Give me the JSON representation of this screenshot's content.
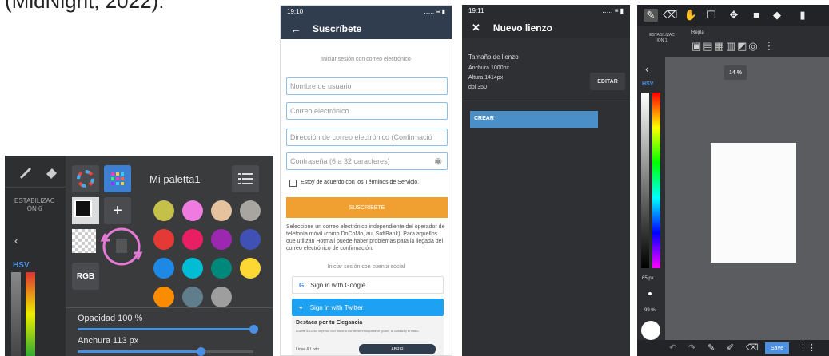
{
  "caption": "(MidNight, 2022).",
  "palette_panel": {
    "stabilizer": "ESTABILIZAC IÓN 6",
    "hsv": "HSV",
    "palette_name": "Mi paletta1",
    "rgb_label": "RGB",
    "opacity_label": "Opacidad 100 %",
    "width_label": "Anchura 113 px",
    "opacity_value": 1.0,
    "width_fraction": 0.7,
    "swatches": [
      "#c5c04a",
      "#f07be0",
      "#e6c39e",
      "#a8a4a0",
      "#e53935",
      "#e91e63",
      "#9c27b0",
      "#3f51b5",
      "#1e88e5",
      "#00bcd4",
      "#00897b",
      "#fdd835",
      "#fb8c00",
      "#607d8b",
      "#9e9e9e"
    ]
  },
  "subscribe_screen": {
    "time": "19:10",
    "signal": "‥… ≡ ▮",
    "title": "Suscríbete",
    "email_login_divider": "Iniciar sesión con correo electrónico",
    "username_placeholder": "Nombre de usuario",
    "email_placeholder": "Correo electrónico",
    "email_confirm_placeholder": "Dirección de correo electrónico (Confirmació",
    "password_placeholder": "Contraseña (6 a 32 caracteres)",
    "terms_label": "Estoy de acuerdo con los Términos de Servicio.",
    "subscribe_button": "SUSCRÍBETE",
    "info_text": "Seleccione un correo electrónico independiente del operador de telefonía móvil (como DoCoMo, au, SoftBank). Para aquellos que utilizan Hotmail puede haber problemas para la llegada del correo electrónico de confirmación.",
    "social_divider": "Iniciar sesión con cuenta social",
    "google_button": "Sign in with Google",
    "twitter_button": "Sign in with Twitter",
    "ad_title": "Destaca por tu Elegancia",
    "ad_text": "Lúzete & Lúdo: impresa con historia donde se enloquese el goure, la calidad y el estilo.",
    "ad_brand": "Liose & Lodo",
    "ad_button": "ABRIR"
  },
  "new_canvas_screen": {
    "time": "19:11",
    "title": "Nuevo lienzo",
    "size_heading": "Tamaño de lienzo",
    "width_line": "Anchura 1000px",
    "height_line": "Altura 1414px",
    "dpi_line": "dpi 350",
    "edit_button": "EDITAR",
    "create_button": "CREAR"
  },
  "drawing_screen": {
    "stabilizer": "ESTABILIZAC IÓN 1",
    "ruler": "Regla",
    "zoom": "14 %",
    "hsv": "HSV",
    "brush_size": "65 px",
    "opacity": "99 %",
    "save_button": "Save"
  },
  "colors": {
    "accent_blue": "#4a90e2",
    "subscribe_orange": "#f0a030",
    "google_text": "#333333",
    "twitter_blue": "#1da1f2",
    "subscribe_header": "#2f3d4f",
    "canvas_dark": "#2f3033"
  }
}
